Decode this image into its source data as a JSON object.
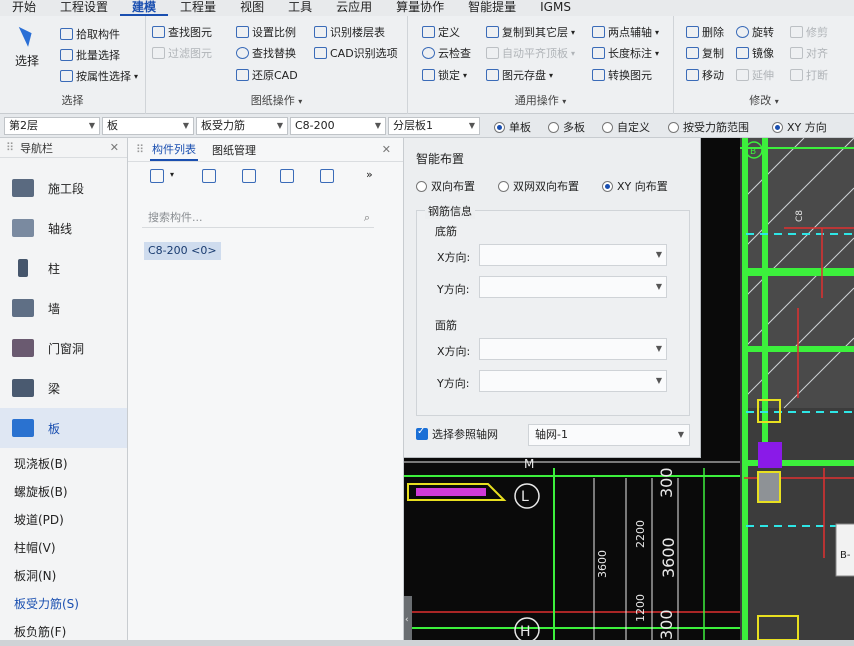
{
  "menubar": {
    "items": [
      {
        "label": "开始",
        "active": false
      },
      {
        "label": "工程设置",
        "active": false
      },
      {
        "label": "建模",
        "active": true
      },
      {
        "label": "工程量",
        "active": false
      },
      {
        "label": "视图",
        "active": false
      },
      {
        "label": "工具",
        "active": false
      },
      {
        "label": "云应用",
        "active": false
      },
      {
        "label": "算量协作",
        "active": false
      },
      {
        "label": "智能提量",
        "active": false
      },
      {
        "label": "IGMS",
        "active": false
      }
    ]
  },
  "ribbon": {
    "select": {
      "big_label": "选择",
      "pick": "拾取构件",
      "batch": "批量选择",
      "by_attr": "按属性选择",
      "title": "选择"
    },
    "drawing": {
      "find": "查找图元",
      "filter": "过滤图元",
      "set_scale": "设置比例",
      "find_replace": "查找替换",
      "restore_cad": "还原CAD",
      "identify_floor": "识别楼层表",
      "cad_options": "CAD识别选项",
      "title": "图纸操作"
    },
    "general": {
      "define": "定义",
      "cloud_check": "云检查",
      "lock": "锁定",
      "copy_floor": "复制到其它层",
      "auto_flat": "自动平齐顶板",
      "save_elem": "图元存盘",
      "two_point_axis": "两点辅轴",
      "length_mark": "长度标注",
      "convert_elem": "转换图元",
      "title": "通用操作"
    },
    "modify": {
      "delete": "删除",
      "rotate": "旋转",
      "trim": "修剪",
      "copy": "复制",
      "mirror": "镜像",
      "align": "对齐",
      "move": "移动",
      "extend": "延伸",
      "break": "打断",
      "title": "修改"
    }
  },
  "proptoolbar": {
    "floor": "第2层",
    "category": "板",
    "type": "板受力筋",
    "spec": "C8-200",
    "layer": "分层板1",
    "radios": [
      {
        "label": "单板",
        "on": true
      },
      {
        "label": "多板",
        "on": false
      },
      {
        "label": "自定义",
        "on": false
      },
      {
        "label": "按受力筋范围",
        "on": false
      },
      {
        "label": "XY 方向",
        "on": true
      }
    ]
  },
  "navpanel": {
    "title": "导航栏",
    "items": [
      {
        "label": "施工段",
        "color": "#5a6a80"
      },
      {
        "label": "轴线",
        "color": "#7a8aa0"
      },
      {
        "label": "柱",
        "color": "#46566c"
      },
      {
        "label": "墙",
        "color": "#5f6f85"
      },
      {
        "label": "门窗洞",
        "color": "#6a5a70"
      },
      {
        "label": "梁",
        "color": "#4a5a70"
      },
      {
        "label": "板",
        "color": "#2a72d0"
      }
    ],
    "sub_items": [
      "现浇板(B)",
      "螺旋板(B)",
      "坡道(PD)",
      "柱帽(V)",
      "板洞(N)",
      "板受力筋(S)",
      "板负筋(F)"
    ],
    "active_sub": 5
  },
  "comppanel": {
    "tabs": [
      "构件列表",
      "图纸管理"
    ],
    "search_placeholder": "搜索构件...",
    "item": "C8-200 <0>"
  },
  "smartdlg": {
    "title": "智能布置",
    "radios": [
      {
        "label": "双向布置",
        "on": false
      },
      {
        "label": "双网双向布置",
        "on": false
      },
      {
        "label": "XY 向布置",
        "on": true
      }
    ],
    "group_title": "钢筋信息",
    "bottom": "底筋",
    "top": "面筋",
    "x_dir": "X方向:",
    "y_dir": "Y方向:",
    "axis_check": "选择参照轴网",
    "axis_value": "轴网-1"
  },
  "canvas": {
    "texts": [
      "M",
      "L",
      "H",
      "B",
      "3600",
      "2200",
      "3600",
      "1200",
      "300",
      "300",
      "B-"
    ]
  }
}
